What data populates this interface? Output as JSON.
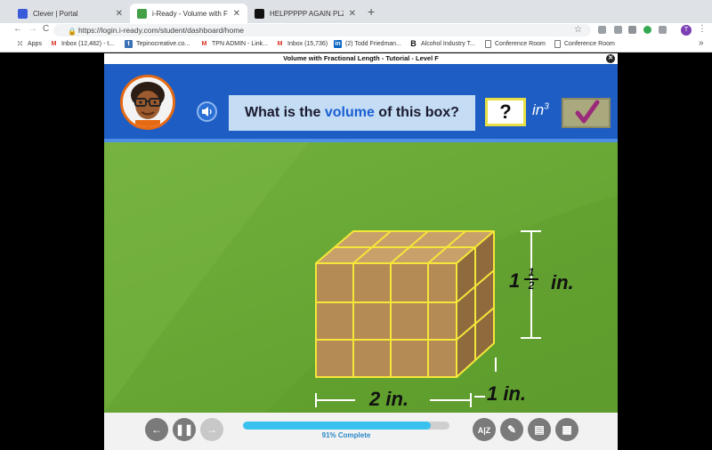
{
  "browser": {
    "tabs": [
      {
        "title": "Clever | Portal",
        "color": "#3a5bd9",
        "active": false
      },
      {
        "title": "i-Ready - Volume with Fraction",
        "color": "#43a047",
        "active": true
      },
      {
        "title": "HELPPPPP AGAIN PLZZZ!!!! :)",
        "color": "#111111",
        "active": false
      }
    ],
    "url": "https://login.i-ready.com/student/dashboard/home",
    "profile_initial": "T",
    "bookmarks": [
      {
        "label": "Apps",
        "icon": "apps-grid-icon"
      },
      {
        "label": "Inbox (12,482) - t...",
        "icon": "gmail-icon"
      },
      {
        "label": "Tepinocreative.co...",
        "icon": "site-icon"
      },
      {
        "label": "TPN ADMIN - Link...",
        "icon": "gmail-icon"
      },
      {
        "label": "Inbox (15,736)",
        "icon": "gmail-icon"
      },
      {
        "label": "(2) Todd Friedman...",
        "icon": "linkedin-icon"
      },
      {
        "label": "Alcohol Industry T...",
        "icon": "b-icon"
      },
      {
        "label": "Conference Room",
        "icon": "doc-icon"
      },
      {
        "label": "Conference Room",
        "icon": "doc-icon"
      }
    ]
  },
  "lesson": {
    "title": "Volume with Fractional Length - Tutorial - Level F",
    "question_prefix": "What is the ",
    "question_highlight": "volume",
    "question_suffix": " of this box?",
    "answer_value": "?",
    "unit_base": "in",
    "unit_exp": "3",
    "height_whole": "1",
    "height_num": "1",
    "height_den": "2",
    "height_unit": "in.",
    "width_label": "2 in.",
    "depth_label": "1 in.",
    "progress_label": "91% Complete",
    "progress": 0.91
  },
  "colors": {
    "header_blue": "#1e5dc4",
    "question_blue": "#1a5fd3",
    "scene_green": "#6aa936",
    "cube_face": "#b48a55",
    "cube_edge": "#f5e63a",
    "progress_fill": "#39c2ee"
  }
}
